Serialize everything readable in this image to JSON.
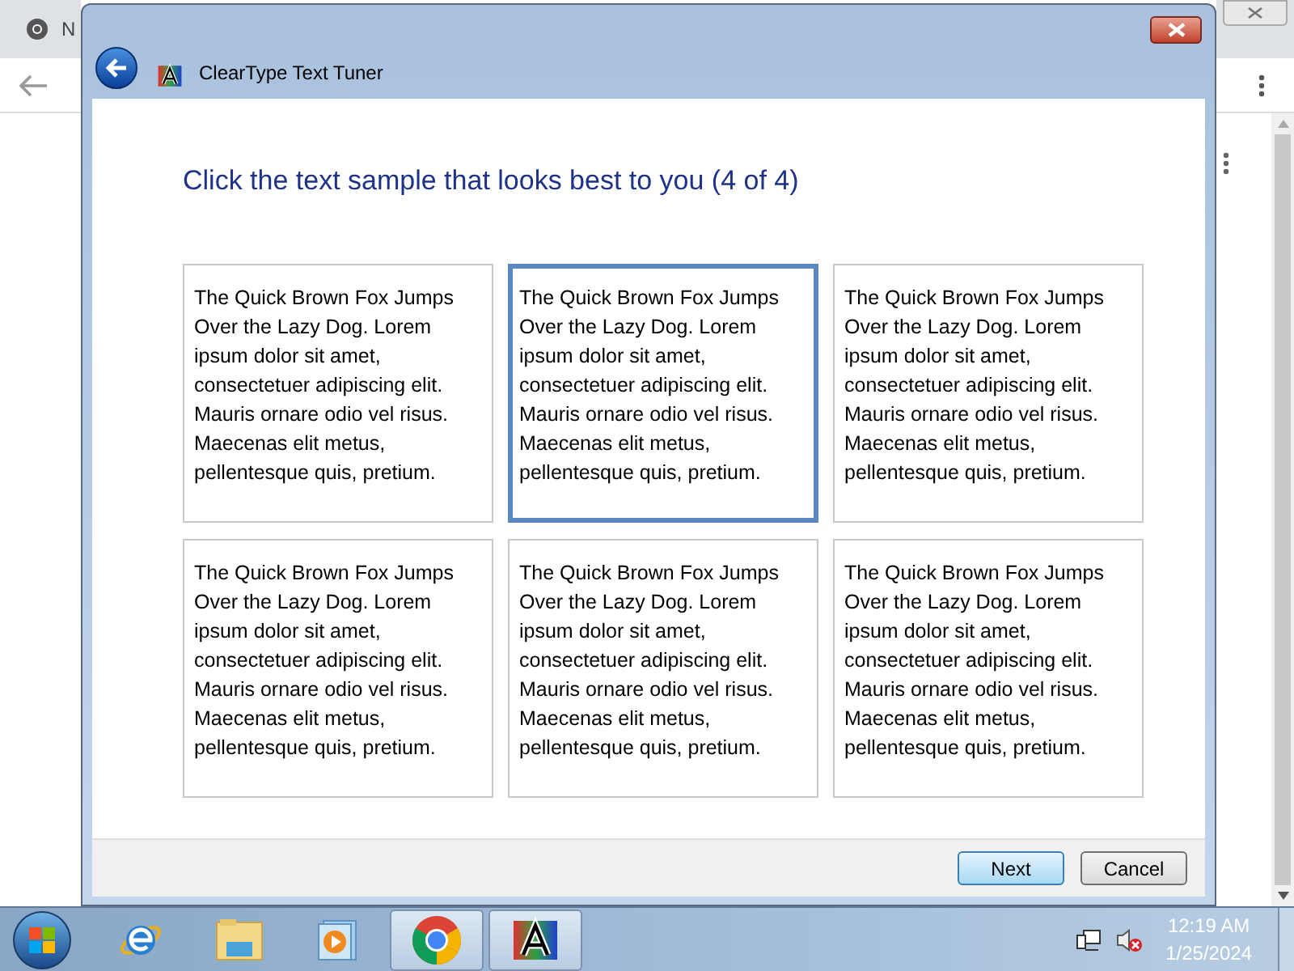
{
  "browser": {
    "tab_title": "N"
  },
  "window": {
    "title": "ClearType Text Tuner"
  },
  "heading": "Click the text sample that looks best to you (4 of 4)",
  "samples": [
    {
      "text": "The Quick Brown Fox Jumps Over the Lazy Dog. Lorem ipsum dolor sit amet, consectetuer adipiscing elit. Mauris ornare odio vel risus. Maecenas elit metus, pellentesque quis, pretium.",
      "selected": false
    },
    {
      "text": "The Quick Brown Fox Jumps Over the Lazy Dog. Lorem ipsum dolor sit amet, consectetuer adipiscing elit. Mauris ornare odio vel risus. Maecenas elit metus, pellentesque quis, pretium.",
      "selected": true
    },
    {
      "text": "The Quick Brown Fox Jumps Over the Lazy Dog. Lorem ipsum dolor sit amet, consectetuer adipiscing elit. Mauris ornare odio vel risus. Maecenas elit metus, pellentesque quis, pretium.",
      "selected": false
    },
    {
      "text": "The Quick Brown Fox Jumps Over the Lazy Dog. Lorem ipsum dolor sit amet, consectetuer adipiscing elit. Mauris ornare odio vel risus. Maecenas elit metus, pellentesque quis, pretium.",
      "selected": false
    },
    {
      "text": "The Quick Brown Fox Jumps Over the Lazy Dog. Lorem ipsum dolor sit amet, consectetuer adipiscing elit. Mauris ornare odio vel risus. Maecenas elit metus, pellentesque quis, pretium.",
      "selected": false
    },
    {
      "text": "The Quick Brown Fox Jumps Over the Lazy Dog. Lorem ipsum dolor sit amet, consectetuer adipiscing elit. Mauris ornare odio vel risus. Maecenas elit metus, pellentesque quis, pretium.",
      "selected": false
    }
  ],
  "buttons": [
    {
      "label": "Next",
      "kind": "primary"
    },
    {
      "label": "Cancel",
      "kind": "normal"
    }
  ],
  "taskbar": {
    "apps": [
      {
        "kind": "ie",
        "open": false
      },
      {
        "kind": "explorer",
        "open": false
      },
      {
        "kind": "media",
        "open": false
      },
      {
        "kind": "chrome",
        "open": true
      },
      {
        "kind": "cleartype",
        "open": true
      }
    ],
    "time": "12:19 AM",
    "date": "1/25/2024"
  }
}
